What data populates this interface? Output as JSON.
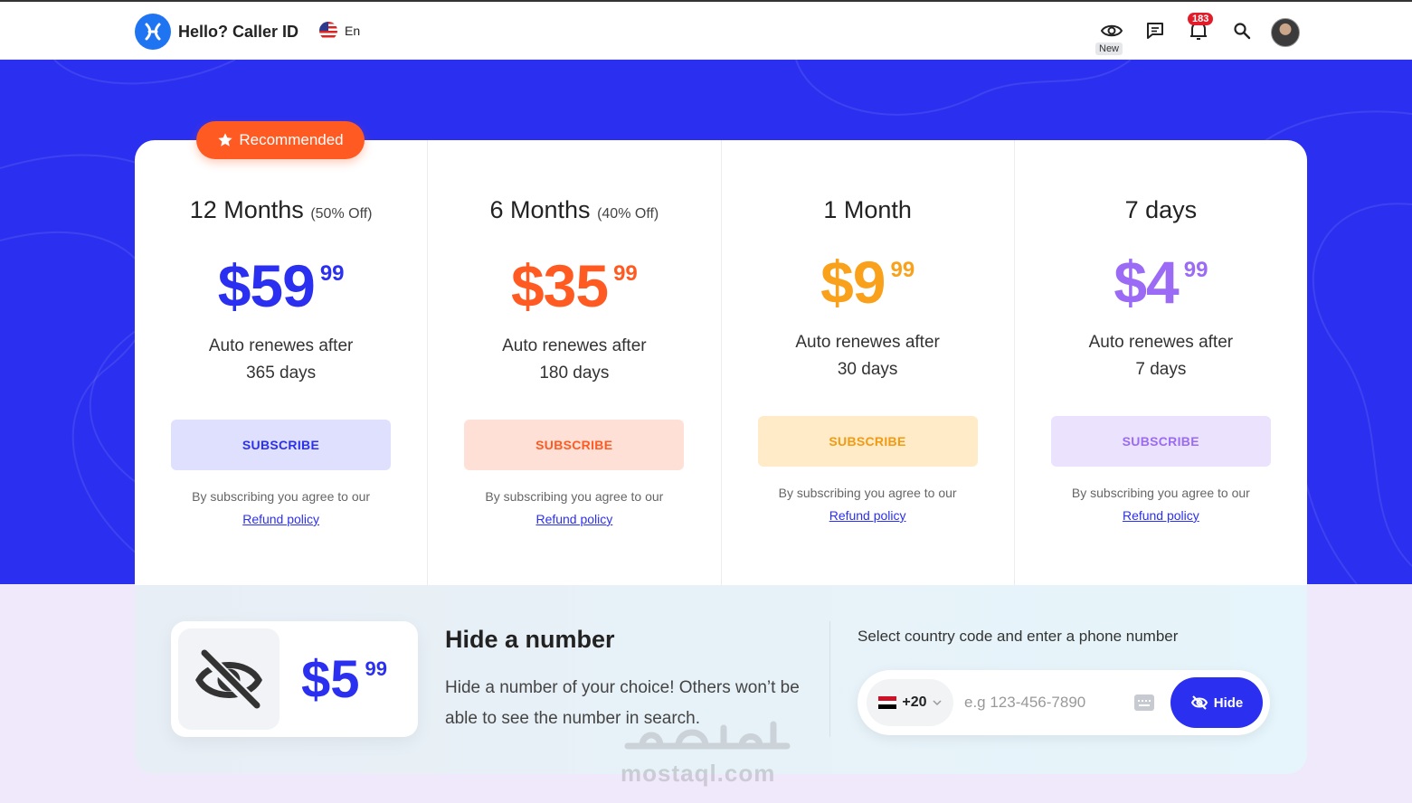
{
  "header": {
    "app_name": "Hello? Caller ID",
    "language": "En",
    "new_tag": "New",
    "notification_count": "183",
    "icons": [
      "eye-icon",
      "chat-icon",
      "bell-icon",
      "search-icon",
      "user-avatar"
    ]
  },
  "recommended_label": "Recommended",
  "plans": [
    {
      "title": "12 Months",
      "discount": "(50% Off)",
      "price": "$59",
      "cents": "99",
      "renew_line1": "Auto renewes after",
      "renew_line2": "365 days",
      "button": "SUBSCRIBE",
      "agree": "By subscribing you agree to our",
      "link": "Refund policy",
      "accent": "#2b30f0",
      "button_bg": "#dfe0fd"
    },
    {
      "title": "6 Months",
      "discount": "(40% Off)",
      "price": "$35",
      "cents": "99",
      "renew_line1": "Auto renewes after",
      "renew_line2": "180 days",
      "button": "SUBSCRIBE",
      "agree": "By subscribing you agree to our",
      "link": "Refund policy",
      "accent": "#ff5a22",
      "button_bg": "#ffe0d6"
    },
    {
      "title": "1 Month",
      "discount": "",
      "price": "$9",
      "cents": "99",
      "renew_line1": "Auto renewes after",
      "renew_line2": "30 days",
      "button": "SUBSCRIBE",
      "agree": "By subscribing you agree to our",
      "link": "Refund policy",
      "accent": "#f9a11b",
      "button_bg": "#ffebc7"
    },
    {
      "title": "7 days",
      "discount": "",
      "price": "$4",
      "cents": "99",
      "renew_line1": "Auto renewes after",
      "renew_line2": "7 days",
      "button": "SUBSCRIBE",
      "agree": "By subscribing you agree to our",
      "link": "Refund policy",
      "accent": "#9b6bf5",
      "button_bg": "#ebe2fd"
    }
  ],
  "hide_number": {
    "price": "$5",
    "cents": "99",
    "title": "Hide a number",
    "description": "Hide a number of your choice! Others won’t be able to see the number in search.",
    "country_label": "Select country code and enter a phone number",
    "country_code": "+20",
    "phone_placeholder": "e.g 123-456-7890",
    "hide_button": "Hide"
  },
  "watermark": "mostaql.com"
}
